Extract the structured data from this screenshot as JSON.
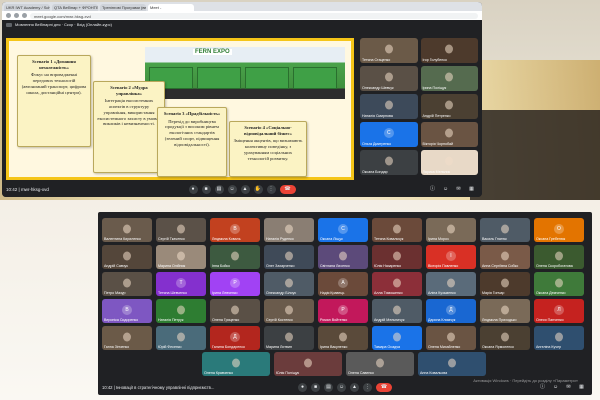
{
  "browser": {
    "tabs": [
      "UKR IWT Academy / Sched...",
      "QTA Вебінар + ФРОНТЕКС (1)",
      "Тренінгові Програми (вебінари)",
      "Meet - "
    ],
    "address": "meet.google.com/mwr-hksg-xvd"
  },
  "meeting": {
    "title": "Мовлення Вебінарні дня · Скор · Вхід (Онлайн-курс)",
    "code": "mwr-hksg-xvd",
    "time_top": "10:42",
    "time_bottom": "10:42",
    "bottom_title": "Інновації в стратегічному управлінні підприємств...",
    "watermark": "Активація Windows · Перейдіть до розділу «Параметри»"
  },
  "slide": {
    "banner_logo": "FERN EXPO",
    "scenarios": [
      {
        "title": "Scenario 1 «Домашня незалежність»",
        "body": "Фокус на впровадженні передових технологій (автономний транспорт, цифрова школа, дистанційні центри)."
      },
      {
        "title": "Scenario 2 «Мудра управлінка»",
        "body": "Інтеграція екосистемних аспектів в структуру управління, використання екосистемного захисту в умовах викликів і невизначеності."
      },
      {
        "title": "Scenario 3 «Прадбільність»",
        "body": "Перехід до виробництва продукції з високим рівнем екологічних стандартів (зелений спорт, підвищення відповідальності)."
      },
      {
        "title": "Scenario 4 «Соціально-відповідальний бізнес»",
        "body": "Зміщення акцентів, що визначають колективну поведінку, з урахуванням соціальних технологій розвитку."
      }
    ]
  },
  "top_participants": [
    {
      "name": "Тетяна Стаценко",
      "initial": "",
      "color": "#6b5a48"
    },
    {
      "name": "Ігор Голубенко",
      "initial": "",
      "color": "#4d3a2c"
    },
    {
      "name": "Олександр Шевчук",
      "initial": "",
      "color": "#5a5046"
    },
    {
      "name": "Ірина Поліщук",
      "initial": "",
      "color": "#556b4f"
    },
    {
      "name": "Наталія Смирнова",
      "initial": "",
      "color": "#3d4a5a"
    },
    {
      "name": "Андрій Петренко",
      "initial": "",
      "color": "#4b4032"
    },
    {
      "name": "Ольга Дмитренко",
      "initial": "С",
      "color": "#1a73e8"
    },
    {
      "name": "Вікторія Чорнобай",
      "initial": "",
      "color": "#6a5443"
    },
    {
      "name": "Оксана Бондар",
      "initial": "",
      "color": "#3c4043"
    },
    {
      "name": "Лариса Мельник",
      "initial": "",
      "color": "#e8d9c7"
    }
  ],
  "grid_participants": [
    {
      "name": "Валентина Кириленко",
      "initial": "",
      "color": "#6a5b4c"
    },
    {
      "name": "Сергій Ткаченко",
      "initial": "",
      "color": "#5b5148"
    },
    {
      "name": "Людмила Коваль",
      "initial": "В",
      "color": "#c2411f"
    },
    {
      "name": "Наталія Руденко",
      "initial": "",
      "color": "#8a7e73"
    },
    {
      "name": "Оксана Ліщук",
      "initial": "С",
      "color": "#1a73e8"
    },
    {
      "name": "Тетяна Ковальчук",
      "initial": "",
      "color": "#6b4a3a"
    },
    {
      "name": "Ірина Мороз",
      "initial": "",
      "color": "#7a6a58"
    },
    {
      "name": "Василь Гнатюк",
      "initial": "",
      "color": "#4f5b66"
    },
    {
      "name": "Оксана Гребенюк",
      "initial": "O",
      "color": "#e37400"
    },
    {
      "name": "Андрій Савчук",
      "initial": "",
      "color": "#54463a"
    },
    {
      "name": "Марина Олійник",
      "initial": "",
      "color": "#9a8a7a"
    },
    {
      "name": "Інна Бойко",
      "initial": "",
      "color": "#3d5a40"
    },
    {
      "name": "Олег Захарченко",
      "initial": "",
      "color": "#3f4a58"
    },
    {
      "name": "Світлана Лисенко",
      "initial": "",
      "color": "#5c4a7a"
    },
    {
      "name": "Юлія Назаренко",
      "initial": "",
      "color": "#6b3030"
    },
    {
      "name": "Вікторія Павленко",
      "initial": "I",
      "color": "#d93025"
    },
    {
      "name": "Анна Сергіївна Собко",
      "initial": "",
      "color": "#7a5a48"
    },
    {
      "name": "Олена Скоробогатова",
      "initial": "",
      "color": "#3b5a2f"
    },
    {
      "name": "Петро Мазур",
      "initial": "",
      "color": "#5a5046"
    },
    {
      "name": "Тетяна Шевченко",
      "initial": "T",
      "color": "#8430ce"
    },
    {
      "name": "Ірина Левченко",
      "initial": "P",
      "color": "#a142f4"
    },
    {
      "name": "Олександр Білоус",
      "initial": "",
      "color": "#4f5b66"
    },
    {
      "name": "Надія Кравець",
      "initial": "A",
      "color": "#6b4a3a"
    },
    {
      "name": "Алла Тимошенко",
      "initial": "",
      "color": "#8c2f39"
    },
    {
      "name": "Аліна Кузьменко",
      "initial": "",
      "color": "#5a6b7a"
    },
    {
      "name": "Марія Гончар",
      "initial": "",
      "color": "#4d3a2c"
    },
    {
      "name": "Оксана Демченко",
      "initial": "",
      "color": "#3f7a3a"
    },
    {
      "name": "Вероніка Сидоренко",
      "initial": "B",
      "color": "#7e57c2"
    },
    {
      "name": "Наталія Петрук",
      "initial": "",
      "color": "#2e7d32"
    },
    {
      "name": "Олена Гриценко",
      "initial": "",
      "color": "#5a5046"
    },
    {
      "name": "Сергій Костенко",
      "initial": "",
      "color": "#6a5b4c"
    },
    {
      "name": "Роман Войтенко",
      "initial": "P",
      "color": "#c2185b"
    },
    {
      "name": "Андрій Мельничук",
      "initial": "",
      "color": "#4f5b66"
    },
    {
      "name": "Дарина Климчук",
      "initial": "Д",
      "color": "#1967d2"
    },
    {
      "name": "Людмила Приходько",
      "initial": "",
      "color": "#7a6a58"
    },
    {
      "name": "Олеся Панченко",
      "initial": "Л",
      "color": "#c5221f"
    },
    {
      "name": "Ганна Зінченко",
      "initial": "",
      "color": "#6b5a48"
    },
    {
      "name": "Юрій Фесенко",
      "initial": "",
      "color": "#4a6b7a"
    },
    {
      "name": "Галина Бондаренко",
      "initial": "Д",
      "color": "#b3261e"
    },
    {
      "name": "Марина Литвин",
      "initial": "",
      "color": "#3c4043"
    },
    {
      "name": "Ірина Вакуленко",
      "initial": "",
      "color": "#5a4a3a"
    },
    {
      "name": "Тамара Осадча",
      "initial": "",
      "color": "#1a73e8"
    },
    {
      "name": "Олена Михайленко",
      "initial": "",
      "color": "#6a5443"
    },
    {
      "name": "Оксана Ярмоленко",
      "initial": "",
      "color": "#4b4032"
    },
    {
      "name": "Ангеліна Кучер",
      "initial": "",
      "color": "#2f4f6f"
    }
  ],
  "last_row": [
    {
      "name": "Олена Кравченко",
      "initial": "",
      "color": "#2a7a7a"
    },
    {
      "name": "Юлія Поліщук",
      "initial": "",
      "color": "#6b3c3c"
    },
    {
      "name": "Олена Савенко",
      "initial": "",
      "color": "#5a5a5a"
    },
    {
      "name": "Анна Ковальова",
      "initial": "",
      "color": "#2f4f6f"
    }
  ]
}
